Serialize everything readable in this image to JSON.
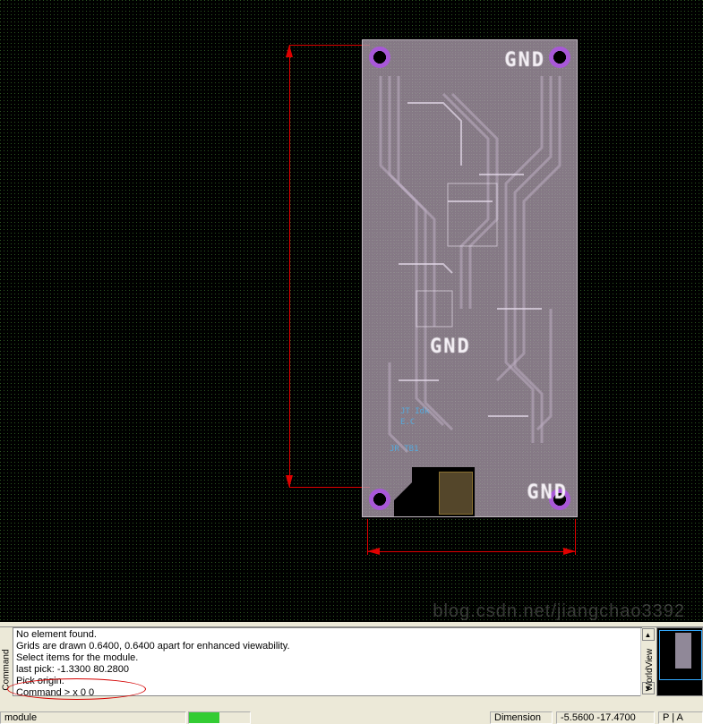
{
  "canvas": {
    "pcb_labels": {
      "gnd1": "GND",
      "gnd2": "GND",
      "gnd3": "GND"
    },
    "dimensions": {
      "vertical_from": 50,
      "vertical_to": 545,
      "horizontal_from": 410,
      "horizontal_to": 643
    }
  },
  "command_panel": {
    "side_label": "Command",
    "log_lines": [
      "No element found.",
      "Grids are drawn 0.6400, 0.6400 apart for enhanced viewability.",
      "Select items for the module.",
      "last pick:  -1.3300  80.2800",
      "Pick origin."
    ],
    "prompt": "Command >",
    "input_value": "x 0 0"
  },
  "overview": {
    "side_label": "WorldView"
  },
  "status_bar": {
    "module_label": "module",
    "dimension_label": "Dimension",
    "coords": "-5.5600  -17.4700",
    "buttons": "P | A"
  },
  "watermark": "blog.csdn.net/jiangchao3392"
}
